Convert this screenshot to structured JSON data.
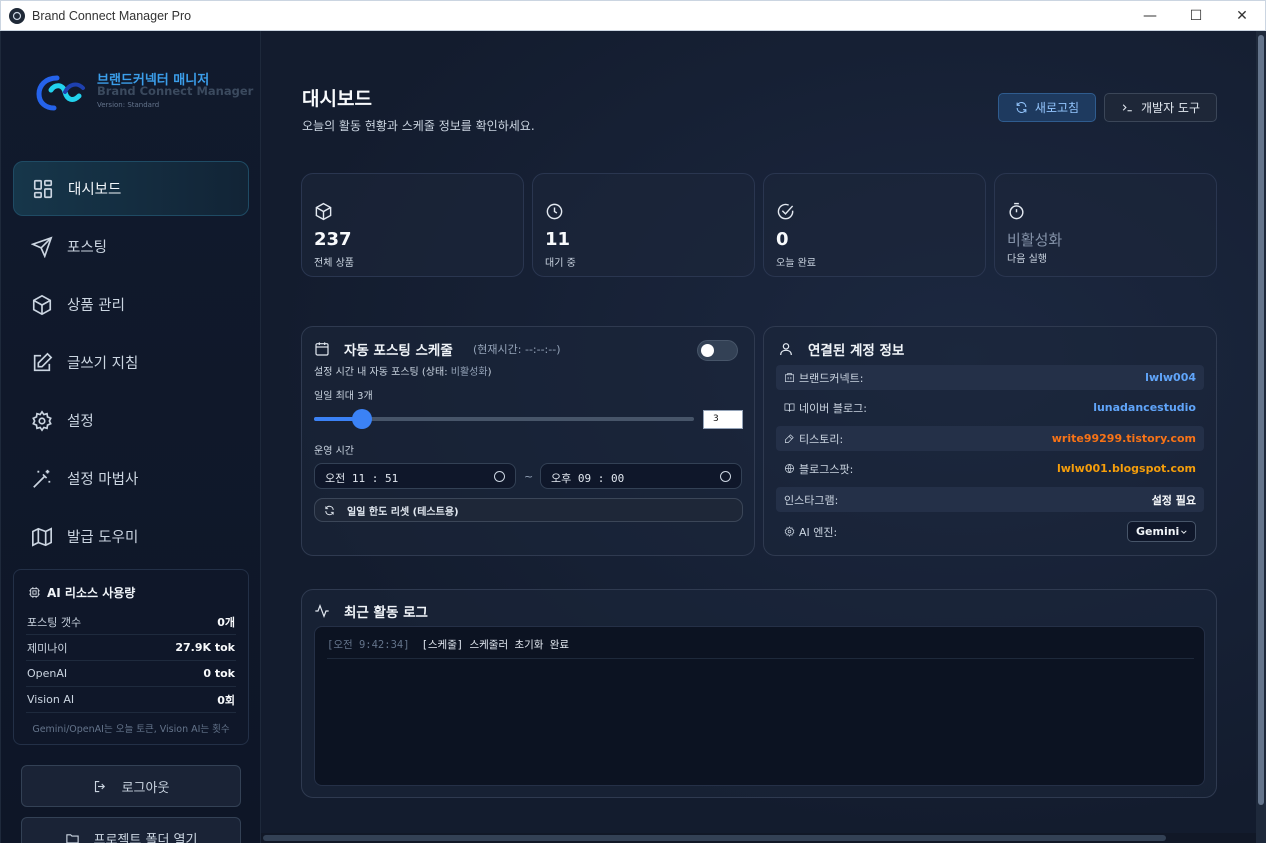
{
  "window": {
    "title": "Brand Connect Manager Pro",
    "minimize": "—",
    "maximize": "☐",
    "close": "✕"
  },
  "sidebar": {
    "logo": {
      "name_ko": "브랜드커넥터 매니저",
      "name_en": "Brand Connect Manager",
      "version": "Version: Standard"
    },
    "nav": [
      {
        "label": "대시보드",
        "icon": "dashboard-icon",
        "active": true
      },
      {
        "label": "포스팅",
        "icon": "send-icon"
      },
      {
        "label": "상품 관리",
        "icon": "box-icon"
      },
      {
        "label": "글쓰기 지침",
        "icon": "edit-icon"
      },
      {
        "label": "설정",
        "icon": "gear-icon"
      },
      {
        "label": "설정 마법사",
        "icon": "magic-wand-icon"
      },
      {
        "label": "발급 도우미",
        "icon": "map-icon"
      }
    ],
    "ai_usage": {
      "title": "AI 리소스 사용량",
      "rows": [
        {
          "label": "포스팅 갯수",
          "value": "0개"
        },
        {
          "label": "제미나이",
          "value": "27.9K tok"
        },
        {
          "label": "OpenAI",
          "value": "0 tok"
        },
        {
          "label": "Vision AI",
          "value": "0회"
        }
      ],
      "note": "Gemini/OpenAI는 오늘 토큰, Vision AI는 횟수"
    },
    "logout_label": "로그아웃",
    "open_folder_label": "프로젝트 폴더 열기"
  },
  "header": {
    "title": "대시보드",
    "subtitle": "오늘의 활동 현황과 스케줄 정보를 확인하세요.",
    "refresh_label": "새로고침",
    "dev_tools_label": "개발자 도구"
  },
  "stats": [
    {
      "value": "237",
      "label": "전체 상품",
      "icon": "box-icon"
    },
    {
      "value": "11",
      "label": "대기 중",
      "icon": "clock-icon"
    },
    {
      "value": "0",
      "label": "오늘 완료",
      "icon": "check-circle-icon"
    },
    {
      "value": "비활성화",
      "label": "다음 실행",
      "icon": "timer-icon"
    }
  ],
  "schedule": {
    "title": "자동 포스팅 스케줄",
    "current_time": "(현재시간: --:--:--)",
    "enabled": false,
    "desc_prefix": "설정 시간 내 자동 포스팅 (상태: ",
    "desc_state": "비활성화",
    "desc_suffix": ")",
    "daily_max_label": "일일 최대 3개",
    "daily_max_value": "3",
    "slider_fraction": 0.13,
    "operation_label": "운영 시간",
    "start_time": "오전  11 : 51",
    "tilde": "~",
    "end_time": "오후  09 : 00",
    "reset_label": "일일 한도 리셋 (테스트용)"
  },
  "accounts": {
    "title": "연결된 계정 정보",
    "rows": [
      {
        "label": "브랜드커넥트:",
        "value": "lwlw004",
        "icon": "building-icon",
        "color": "blue"
      },
      {
        "label": "네이버 블로그:",
        "value": "lunadancestudio",
        "icon": "book-icon",
        "color": "blue"
      },
      {
        "label": "티스토리:",
        "value": "write99299.tistory.com",
        "icon": "pen-icon",
        "color": "orange"
      },
      {
        "label": "블로그스팟:",
        "value": "lwlw001.blogspot.com",
        "icon": "globe-icon",
        "color": "yellow"
      },
      {
        "label": "인스타그램:",
        "value": "설정 필요",
        "icon": "",
        "color": "white"
      }
    ],
    "ai_engine_label": "AI 엔진:",
    "ai_engine_value": "Gemini"
  },
  "log": {
    "title": "최근 활동 로그",
    "entries": [
      {
        "time": "[오전 9:42:34]",
        "message": "[스케줄] 스케줄러 초기화 완료"
      }
    ]
  },
  "colors": {
    "accent": "#3b82f6",
    "background": "#0f172a",
    "link_blue": "#60a5fa",
    "link_orange": "#f97316",
    "link_yellow": "#f59e0b"
  }
}
